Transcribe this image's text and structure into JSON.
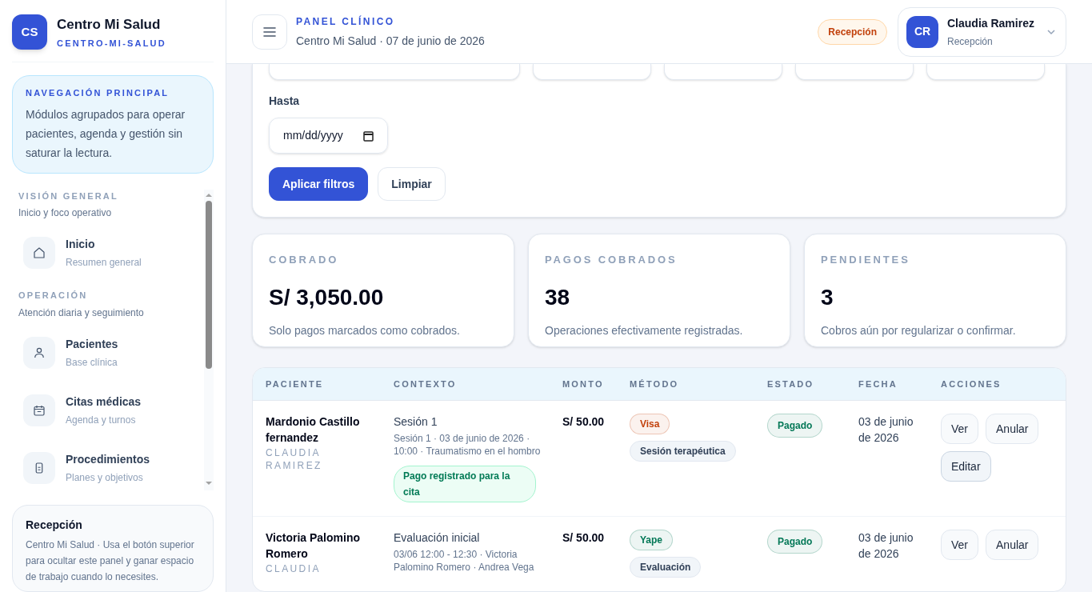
{
  "sidebar": {
    "logo": "CS",
    "brand": "Centro Mi Salud",
    "slug": "CENTRO-MI-SALUD",
    "intro": {
      "title": "NAVEGACIÓN PRINCIPAL",
      "text": "Módulos agrupados para operar pacientes, agenda y gestión sin saturar la lectura."
    },
    "groups": [
      {
        "title": "VISIÓN GENERAL",
        "subtitle": "Inicio y foco operativo",
        "items": [
          {
            "label": "Inicio",
            "sub": "Resumen general"
          }
        ]
      },
      {
        "title": "OPERACIÓN",
        "subtitle": "Atención diaria y seguimiento",
        "items": [
          {
            "label": "Pacientes",
            "sub": "Base clínica"
          },
          {
            "label": "Citas médicas",
            "sub": "Agenda y turnos"
          },
          {
            "label": "Procedimientos",
            "sub": "Planes y objetivos"
          }
        ]
      }
    ],
    "footer": {
      "title": "Recepción",
      "text": "Centro Mi Salud · Usa el botón superior para ocultar este panel y ganar espacio de trabajo cuando lo necesites."
    }
  },
  "header": {
    "eyebrow": "PANEL CLÍNICO",
    "subtitle": "Centro Mi Salud · 07 de junio de 2026",
    "role_badge": "Recepción",
    "user": {
      "initials": "CR",
      "name": "Claudia Ramirez",
      "role": "Recepción"
    }
  },
  "filters": {
    "date_field": {
      "label": "Hasta",
      "placeholder": "mm/dd/yyyy"
    },
    "buttons": [
      {
        "label": "Aplicar filtros",
        "kind": "primary"
      },
      {
        "label": "Limpiar",
        "kind": "secondary"
      }
    ]
  },
  "stats": [
    {
      "label": "COBRADO",
      "value": "S/ 3,050.00",
      "note": "Solo pagos marcados como cobrados."
    },
    {
      "label": "PAGOS COBRADOS",
      "value": "38",
      "note": "Operaciones efectivamente registradas."
    },
    {
      "label": "PENDIENTES",
      "value": "3",
      "note": "Cobros aún por regularizar o confirmar."
    }
  ],
  "table": {
    "columns": [
      "PACIENTE",
      "CONTEXTO",
      "MONTO",
      "MÉTODO",
      "ESTADO",
      "FECHA",
      "ACCIONES"
    ],
    "rows": [
      {
        "patient": "Mardonio Castillo fernandez",
        "professional": "CLAUDIA RAMIREZ",
        "context": "Sesión 1",
        "detail": "Sesión 1 · 03 de junio de 2026 · 10:00 · Traumatismo en el hombro",
        "note": "Pago registrado para la cita",
        "amount": "S/ 50.00",
        "method": {
          "label": "Visa",
          "color": "#c2410c"
        },
        "category": "Sesión terapéutica",
        "status": {
          "label": "Pagado",
          "color": "#047857"
        },
        "date": "03 de junio de 2026",
        "actions": [
          {
            "label": "Ver",
            "kind": "plain"
          },
          {
            "label": "Anular",
            "kind": "plain"
          },
          {
            "label": "Editar",
            "kind": "emphasis"
          }
        ]
      },
      {
        "patient": "Victoria Palomino Romero",
        "professional": "CLAUDIA",
        "context": "Evaluación inicial",
        "detail": "03/06 12:00 - 12:30 · Victoria Palomino Romero · Andrea Vega",
        "amount": "S/ 50.00",
        "method": {
          "label": "Yape",
          "color": "#047857"
        },
        "category": "Evaluación",
        "status": {
          "label": "Pagado",
          "color": "#047857"
        },
        "date": "03 de junio de 2026",
        "actions": [
          {
            "label": "Ver",
            "kind": "plain"
          },
          {
            "label": "Anular",
            "kind": "plain"
          }
        ]
      }
    ]
  }
}
